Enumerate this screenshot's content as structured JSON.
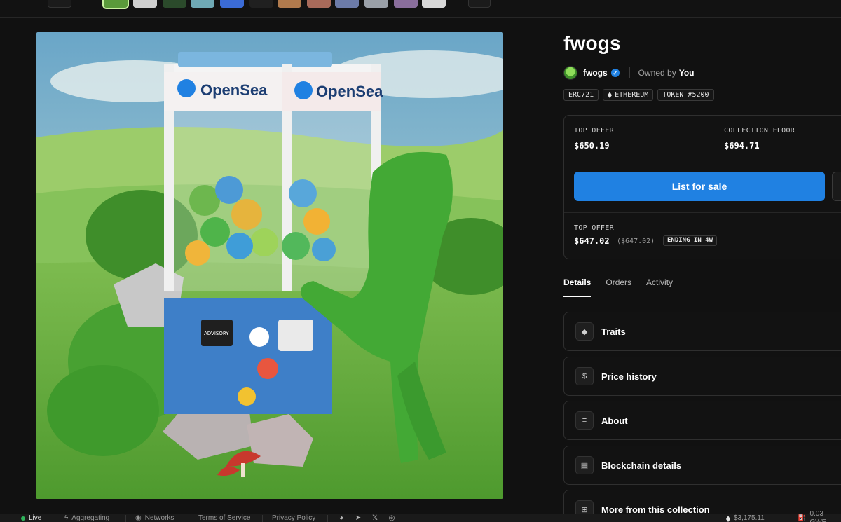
{
  "nft": {
    "title": "fwogs",
    "collection": "fwogs",
    "owned_by_label": "Owned by",
    "owner": "You",
    "tags": [
      "ERC721",
      "ETHEREUM",
      "TOKEN #5200"
    ]
  },
  "artwork": {
    "machine_brand": "OpenSea",
    "sticker_text": "ADVISORY"
  },
  "pricing": {
    "top_offer_label": "TOP OFFER",
    "top_offer_value": "$650.19",
    "floor_label": "COLLECTION FLOOR",
    "floor_value": "$694.71",
    "list_button": "List for sale",
    "top_offer_label_2": "TOP OFFER",
    "top_offer_value_2": "$647.02",
    "top_offer_sub": "($647.02)",
    "ending_badge": "ENDING IN 4W"
  },
  "tabs": [
    "Details",
    "Orders",
    "Activity"
  ],
  "sections": [
    {
      "label": "Traits",
      "icon": "diamond-icon"
    },
    {
      "label": "Price history",
      "icon": "dollar-icon"
    },
    {
      "label": "About",
      "icon": "text-edit-icon"
    },
    {
      "label": "Blockchain details",
      "icon": "block-icon"
    },
    {
      "label": "More from this collection",
      "icon": "grid-icon"
    }
  ],
  "status_bar": {
    "live": "Live",
    "aggregating": "Aggregating",
    "networks": "Networks",
    "terms": "Terms of Service",
    "privacy": "Privacy Policy",
    "eth_price": "$3,175.11",
    "gas": "0.03 GWE"
  },
  "colors": {
    "accent": "#2081e2",
    "background": "#111111",
    "live": "#2fb35a"
  }
}
